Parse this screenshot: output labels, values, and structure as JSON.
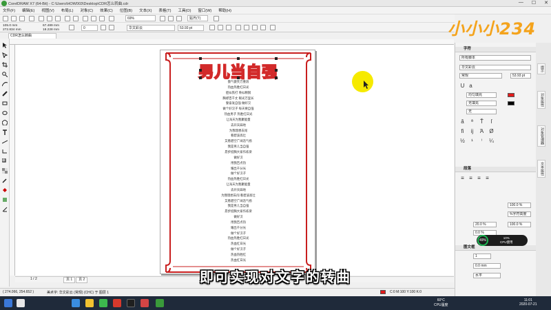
{
  "window": {
    "title": "CorelDRAW X7 (64-Bit) - C:\\Users\\HOW003\\Desktop\\CDR怎么转曲.cdr",
    "controls": [
      "—",
      "☐",
      "✕"
    ]
  },
  "menu": [
    "文件(F)",
    "编辑(E)",
    "视图(V)",
    "布局(L)",
    "对象(C)",
    "效果(C)",
    "位图(B)",
    "文本(X)",
    "表格(T)",
    "工具(O)",
    "窗口(W)",
    "帮助(H)"
  ],
  "standard_toolbar": {
    "zoom": "69%",
    "snap_label": "贴齐(T)"
  },
  "property_bar": {
    "x": "105.0 mm",
    "y": "272.834 mm",
    "w": "67.489 mm",
    "h": "18.228 mm",
    "angle": "0",
    "font_name": "华文彩云",
    "font_size": "53.93 pt"
  },
  "document_tab": "CDR怎么转曲",
  "artwork": {
    "title": "男儿当自强",
    "lines": [
      "傲气傲笑万重浪",
      "热血热胜红日光",
      "胆似铁打 骨似精钢",
      "胸襟百千丈 眼光万里长",
      "誓奋发自强 做好汉",
      "做个好汉子 每天要自强",
      "热血男子 热胜红日光",
      "让海天为我聚能量",
      "去开天辟地",
      "为我理想去闯",
      "看碧波高壮",
      "又看碧空广阔浩气扬",
      "我是男儿当自强",
      "昂步挺胸大家作栋梁",
      "做好汉",
      "用我百点热",
      "耀出千分光",
      "做个好汉子",
      "热血热胜红日光",
      "让海天为我聚能量",
      "去开天辟地",
      "为我理想去闯 看碧波高壮",
      "又看碧空广阔浩气扬",
      "我是男儿当自强",
      "昂步挺胸大家作栋梁",
      "做好汉",
      "用我百点热",
      "耀出千分光",
      "做个好汉子",
      "热血热胜红日光",
      "热血红日光",
      "做个好汉子",
      "热血热胜红",
      "热血红日光"
    ]
  },
  "page_nav": {
    "page": "1 / 2",
    "tabs": [
      "页 1",
      "页 2"
    ]
  },
  "subtitle": "即可实现对文字的转曲",
  "status": {
    "coords": "( 274.066, 254.652 )",
    "object": "美术字: 华文彩云 (常规) (CHC) 于 图层 1",
    "color": "C:0 M:100 Y:100 K:0"
  },
  "logo": "小小小234",
  "dock": {
    "char_panel": "字符",
    "font_category": "所有脚本",
    "font_name": "华文彩云",
    "font_style": "常规",
    "font_size": "53.93 pt",
    "fill_label": "均匀填充",
    "outline_label": "无填充",
    "bg_label": "无",
    "para_panel": "段落",
    "para_val1": "100.0 %",
    "para_val2": "%字符高度",
    "para_val3": "20.0 %",
    "para_val4": "100.0 %",
    "para_val5": "0.0 %",
    "frame_panel": "图文框",
    "frame_val1": "1",
    "frame_val2": "0.0 mm",
    "frame_val3": "水平",
    "colors": {
      "red": "#e21b1b",
      "black": "#000000"
    }
  },
  "side_tabs": [
    "提示",
    "对象属性",
    "对象管理器",
    "文本属性"
  ],
  "cpu": {
    "percent": "49%",
    "label": "CPU使用",
    "value": "10%"
  },
  "taskbar": {
    "temp": "60°C",
    "temp_label": "CPU温度",
    "time": "11:01",
    "date": "2020-07-21"
  }
}
